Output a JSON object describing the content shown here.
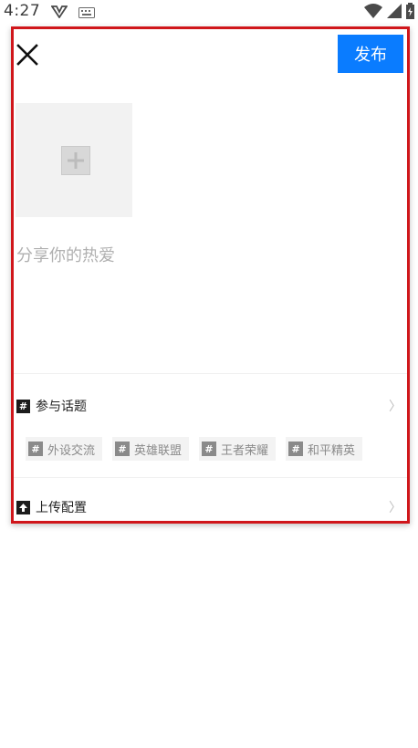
{
  "status_bar": {
    "time": "4:27"
  },
  "dialog": {
    "publish_label": "发布",
    "placeholder": "分享你的热爱",
    "topics": {
      "label": "参与话题",
      "icon_glyph": "#",
      "chevron": "〉",
      "tags": [
        {
          "label": "外设交流"
        },
        {
          "label": "英雄联盟"
        },
        {
          "label": "王者荣耀"
        },
        {
          "label": "和平精英"
        }
      ]
    },
    "upload_config": {
      "label": "上传配置",
      "chevron": "〉"
    }
  },
  "colors": {
    "accent": "#0a7cff",
    "highlight_border": "#d0161b"
  }
}
